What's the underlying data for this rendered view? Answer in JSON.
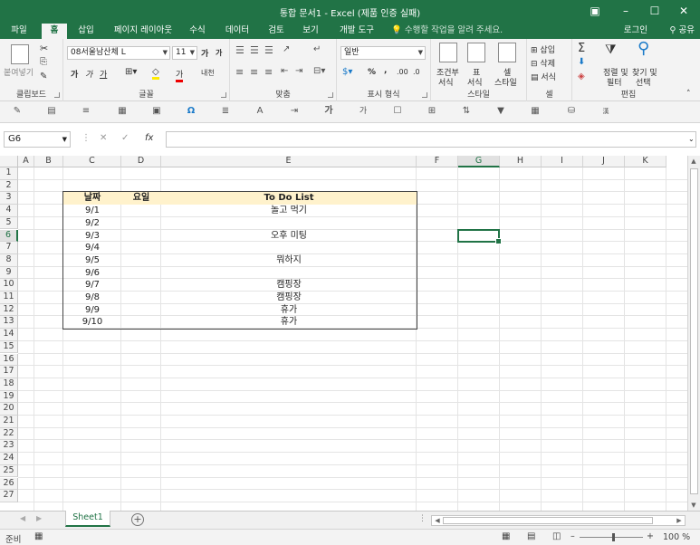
{
  "titlebar": {
    "title": "통합 문서1 - Excel (제품 인증 실패)",
    "ribbon_display_icon": "ribbon-display-icon",
    "minimize": "–",
    "maximize": "☐",
    "close": "✕"
  },
  "menu": {
    "tabs": [
      "파일",
      "홈",
      "삽입",
      "페이지 레이아웃",
      "수식",
      "데이터",
      "검토",
      "보기",
      "개발 도구"
    ],
    "active_tab": "홈",
    "tell_me": "수행할 작업을 알려 주세요.",
    "login": "로그인",
    "share": "공유"
  },
  "ribbon": {
    "clipboard": {
      "paste": "붙여넣기",
      "label": "클립보드"
    },
    "font": {
      "font_name": "08서울남산체 L",
      "font_size": "11",
      "grow": "가",
      "shrink": "가",
      "bold": "가",
      "italic": "가",
      "underline": "가",
      "phonetic": "내천",
      "label": "글꼴"
    },
    "alignment": {
      "label": "맞춤"
    },
    "number": {
      "format": "일반",
      "percent": "%",
      "comma": ",",
      "inc_decimal": ".00",
      "dec_decimal": ".0",
      "label": "표시 형식"
    },
    "styles": {
      "conditional": "조건부",
      "conditional2": "서식",
      "table": "표",
      "table2": "서식",
      "cell": "셀",
      "cell2": "스타일",
      "label": "스타일"
    },
    "cells": {
      "insert": "삽입",
      "delete": "삭제",
      "format": "서식",
      "label": "셀"
    },
    "editing": {
      "sort": "정렬 및",
      "sort2": "필터",
      "find": "찾기 및",
      "find2": "선택",
      "label": "편집"
    }
  },
  "formula_bar": {
    "name_box": "G6",
    "fx": "fx",
    "formula": ""
  },
  "grid": {
    "columns": [
      "A",
      "B",
      "C",
      "D",
      "E",
      "F",
      "G",
      "H",
      "I",
      "J",
      "K"
    ],
    "selected_column": "G",
    "rows": [
      "1",
      "2",
      "3",
      "4",
      "5",
      "6",
      "7",
      "8",
      "9",
      "10",
      "11",
      "12",
      "13",
      "14",
      "15",
      "16",
      "17",
      "18",
      "19",
      "20",
      "21",
      "22",
      "23",
      "24",
      "25",
      "26",
      "27"
    ],
    "selected_row": "6"
  },
  "todo_table": {
    "headers": {
      "date": "날짜",
      "day": "요일",
      "todo": "To Do List"
    },
    "rows": [
      {
        "date": "9/1",
        "day": "",
        "todo": "놀고 먹기"
      },
      {
        "date": "9/2",
        "day": "",
        "todo": ""
      },
      {
        "date": "9/3",
        "day": "",
        "todo": "오후 미팅"
      },
      {
        "date": "9/4",
        "day": "",
        "todo": ""
      },
      {
        "date": "9/5",
        "day": "",
        "todo": "뭐하지"
      },
      {
        "date": "9/6",
        "day": "",
        "todo": ""
      },
      {
        "date": "9/7",
        "day": "",
        "todo": "캠핑장"
      },
      {
        "date": "9/8",
        "day": "",
        "todo": "캠핑장"
      },
      {
        "date": "9/9",
        "day": "",
        "todo": "휴가"
      },
      {
        "date": "9/10",
        "day": "",
        "todo": "휴가"
      }
    ]
  },
  "sheets": {
    "active": "Sheet1",
    "add": "+"
  },
  "statusbar": {
    "ready": "준비",
    "zoom": "100 %"
  },
  "colors": {
    "accent": "#217346",
    "header_fill": "#fff2cc"
  }
}
